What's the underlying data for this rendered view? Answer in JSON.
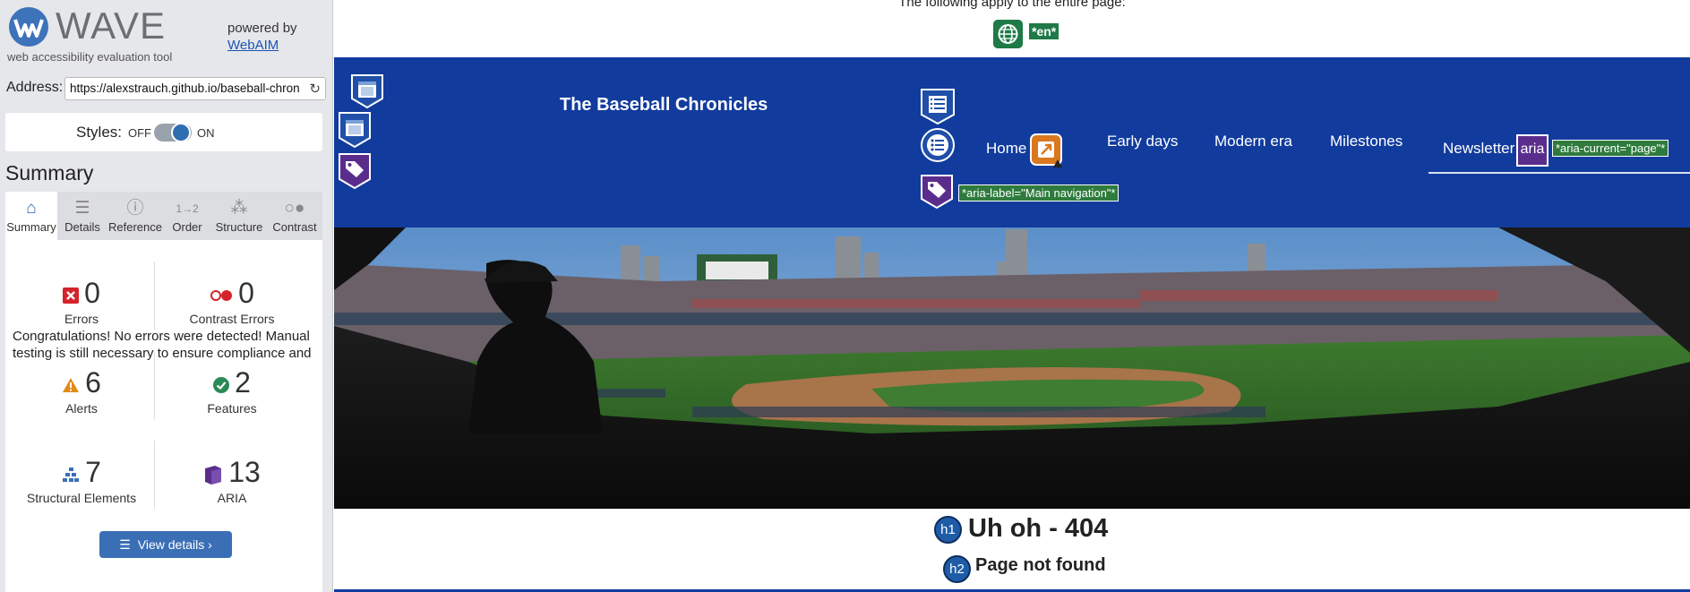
{
  "sidebar": {
    "brand": {
      "name": "WAVE",
      "tagline": "web accessibility evaluation tool",
      "powered_by": "powered by",
      "powered_link": "WebAIM"
    },
    "address": {
      "label": "Address:",
      "value": "https://alexstrauch.github.io/baseball-chron"
    },
    "styles": {
      "label": "Styles:",
      "off": "OFF",
      "on": "ON"
    },
    "summary_title": "Summary",
    "tabs": [
      {
        "label": "Summary",
        "icon": "home-icon",
        "active": true
      },
      {
        "label": "Details",
        "icon": "list-icon"
      },
      {
        "label": "Reference",
        "icon": "info-icon"
      },
      {
        "label": "Order",
        "icon": "order-icon"
      },
      {
        "label": "Structure",
        "icon": "structure-icon"
      },
      {
        "label": "Contrast",
        "icon": "contrast-icon"
      }
    ],
    "stats": {
      "errors": {
        "value": "0",
        "label": "Errors"
      },
      "contrast_errors": {
        "value": "0",
        "label": "Contrast Errors"
      },
      "alerts": {
        "value": "6",
        "label": "Alerts"
      },
      "features": {
        "value": "2",
        "label": "Features"
      },
      "structural": {
        "value": "7",
        "label": "Structural Elements"
      },
      "aria": {
        "value": "13",
        "label": "ARIA"
      }
    },
    "view_details": "View details ›",
    "congrats": "Congratulations! No errors were detected! Manual testing is still necessary to ensure compliance and"
  },
  "page": {
    "note": "The following apply to the entire page:",
    "lang_badge": "*en*",
    "site_title": "The Baseball Chronicles",
    "nav": [
      "Home",
      "Early days",
      "Modern era",
      "Milestones",
      "Newsletter"
    ],
    "aria_label_badge": "*aria-label=\"Main navigation\"*",
    "aria_current_badge": "*aria-current=\"page\"*",
    "aria_tag": "aria",
    "h1_badge": "h1",
    "h1": "Uh oh - 404",
    "h2_badge": "h2",
    "h2": "Page not found"
  },
  "colors": {
    "header_bg": "#123b9e",
    "feature_green": "#1e7a46",
    "aria_purple": "#5a2d8c",
    "alert_orange": "#d9781f",
    "wave_blue": "#3a6fb6"
  }
}
